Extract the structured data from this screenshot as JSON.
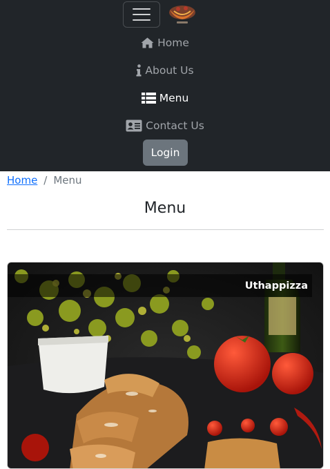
{
  "navbar": {
    "toggler_icon": "hamburger-menu-icon",
    "logo_icon": "brand-logo",
    "items": [
      {
        "label": "Home",
        "icon": "home-icon",
        "active": false
      },
      {
        "label": "About Us",
        "icon": "info-icon",
        "active": false
      },
      {
        "label": "Menu",
        "icon": "list-icon",
        "active": true
      },
      {
        "label": "Contact Us",
        "icon": "address-card-icon",
        "active": false
      }
    ],
    "login_label": "Login"
  },
  "breadcrumb": {
    "home": "Home",
    "separator": "/",
    "current": "Menu"
  },
  "page": {
    "title": "Menu"
  },
  "menu_items": [
    {
      "name": "Uthappizza"
    }
  ],
  "colors": {
    "navbar_bg": "#212529",
    "nav_text": "#a1a5aa",
    "nav_active": "#ffffff",
    "login_bg": "#6c757d",
    "link": "#0d6efd"
  }
}
